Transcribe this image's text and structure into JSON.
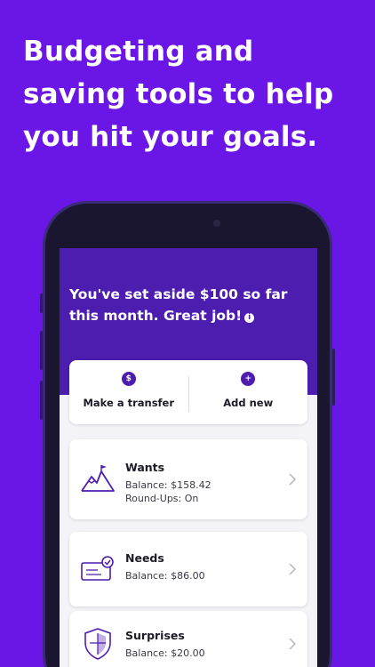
{
  "headline": "Budgeting and saving tools to help you hit your goals.",
  "hero": {
    "message": "You've set aside $100 so far this month. Great job!",
    "info_icon": "i"
  },
  "actions": [
    {
      "label": "Make a transfer",
      "icon": "transfer-icon",
      "glyph": "$"
    },
    {
      "label": "Add new",
      "icon": "plus-icon",
      "glyph": "+"
    }
  ],
  "goals": [
    {
      "name": "Wants",
      "balance": "Balance: $158.42",
      "roundups": "Round-Ups: On",
      "icon": "mountain-icon"
    },
    {
      "name": "Needs",
      "balance": "Balance: $86.00",
      "icon": "check-card-icon"
    },
    {
      "name": "Surprises",
      "balance": "Balance: $20.00",
      "icon": "shield-icon"
    }
  ],
  "colors": {
    "background": "#6a16e6",
    "brand": "#4d1db0",
    "card": "#ffffff"
  }
}
